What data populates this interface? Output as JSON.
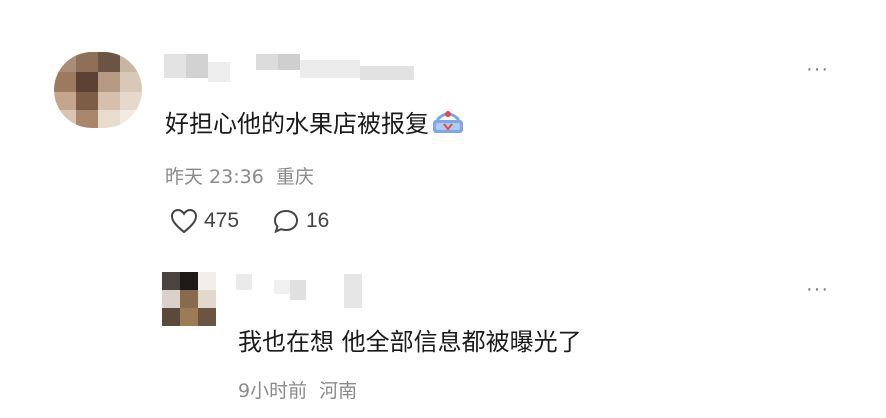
{
  "main_comment": {
    "text": "好担心他的水果店被报复",
    "time": "昨天 23:36",
    "location": "重庆",
    "likes": "475",
    "replies": "16",
    "more_label": "···"
  },
  "reply_comment": {
    "text": "我也在想 他全部信息都被曝光了",
    "time": "9小时前",
    "location": "河南",
    "more_label": "···"
  },
  "colors": {
    "meta_text": "#8a8a8a",
    "main_text": "#1a1a1a",
    "icon": "#444444"
  }
}
